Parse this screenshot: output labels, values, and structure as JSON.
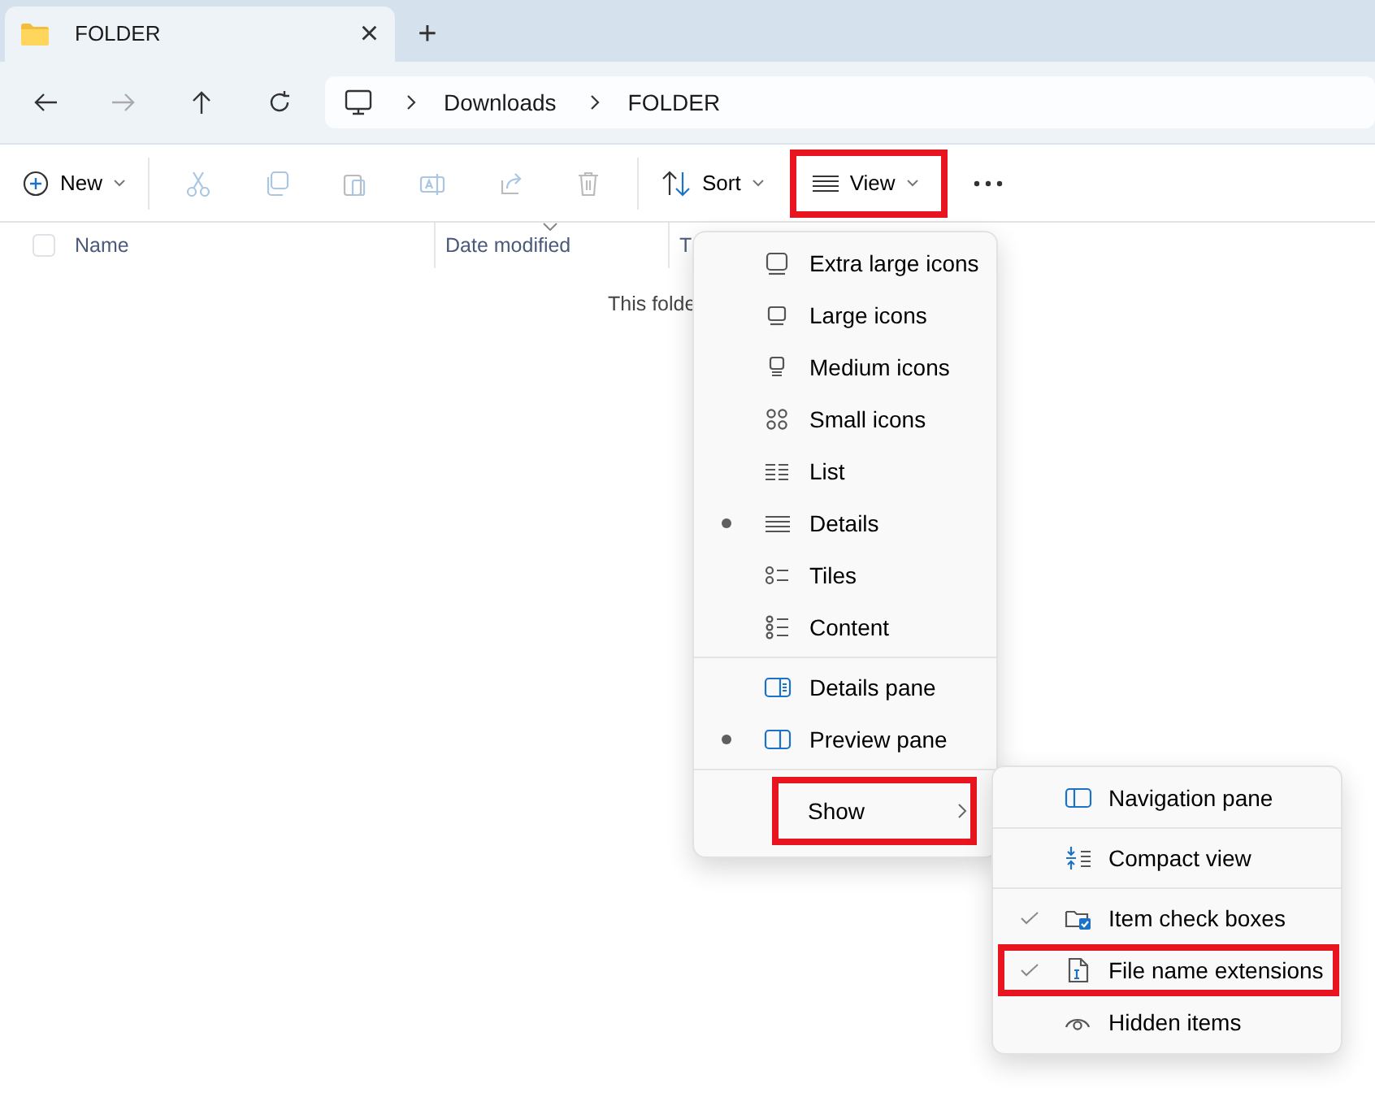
{
  "tab": {
    "title": "FOLDER",
    "close": "×"
  },
  "new_tab": "+",
  "breadcrumb": [
    "Downloads",
    "FOLDER"
  ],
  "toolbar": {
    "new": "New",
    "sort": "Sort",
    "view": {
      "label": "View",
      "highlighted": true
    }
  },
  "select_all": {
    "checked": false
  },
  "columns": [
    {
      "label": "Name"
    },
    {
      "label": "Date modified",
      "sorted": true
    },
    {
      "label": "T"
    }
  ],
  "empty_message": "This folde",
  "view_menu": {
    "groups": [
      [
        {
          "label": "Extra large icons",
          "kind": "xl",
          "selected": false
        },
        {
          "label": "Large icons",
          "kind": "large",
          "selected": false
        },
        {
          "label": "Medium icons",
          "kind": "medium",
          "selected": false
        },
        {
          "label": "Small icons",
          "kind": "small",
          "selected": false
        },
        {
          "label": "List",
          "kind": "list",
          "selected": false
        },
        {
          "label": "Details",
          "kind": "details",
          "selected": true
        },
        {
          "label": "Tiles",
          "kind": "tiles",
          "selected": false
        },
        {
          "label": "Content",
          "kind": "content",
          "selected": false
        }
      ],
      [
        {
          "label": "Details pane",
          "kind": "detailspane",
          "selected": false
        },
        {
          "label": "Preview pane",
          "kind": "previewpane",
          "selected": true
        }
      ]
    ],
    "show": {
      "label": "Show",
      "highlighted": true
    }
  },
  "show_menu": {
    "groups": [
      [
        {
          "label": "Navigation pane",
          "kind": "navpane",
          "checked": false,
          "highlighted": false
        }
      ],
      [
        {
          "label": "Compact view",
          "kind": "compact",
          "checked": false,
          "highlighted": false
        }
      ],
      [
        {
          "label": "Item check boxes",
          "kind": "checkboxes",
          "checked": true,
          "highlighted": false
        },
        {
          "label": "File name extensions",
          "kind": "extensions",
          "checked": true,
          "highlighted": true
        },
        {
          "label": "Hidden items",
          "kind": "hidden",
          "checked": false,
          "highlighted": false
        }
      ]
    ]
  }
}
